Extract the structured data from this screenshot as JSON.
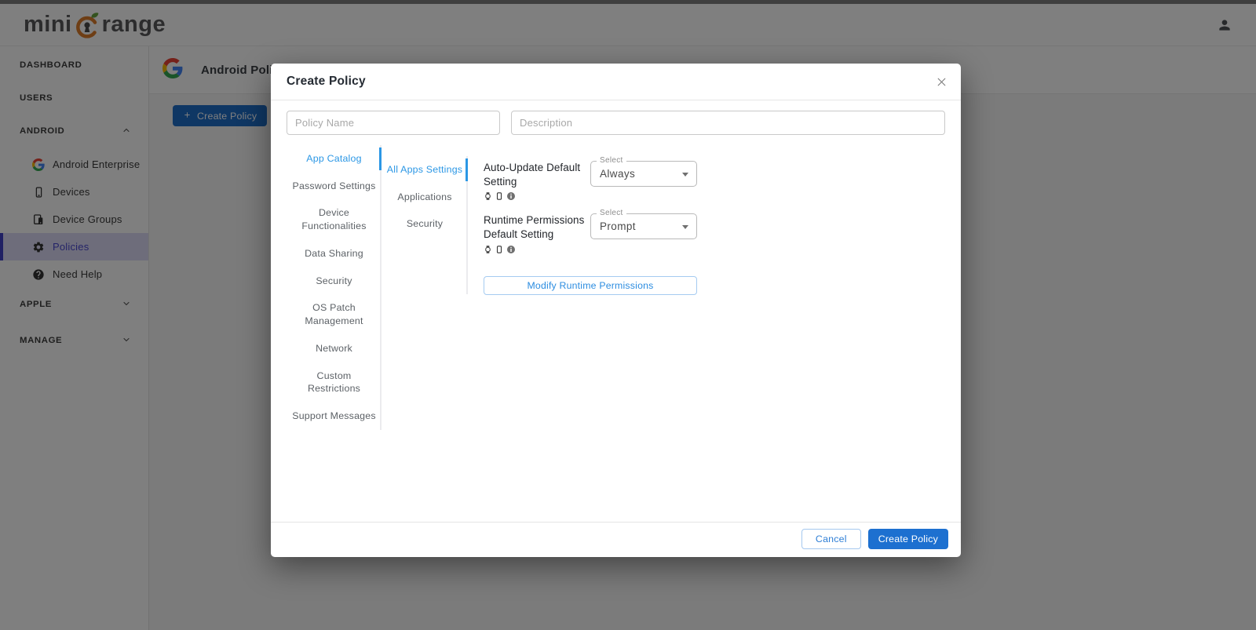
{
  "appbar": {
    "logo_mini": "mini",
    "logo_range": "range"
  },
  "sidebar": {
    "dashboard": "DASHBOARD",
    "users": "USERS",
    "android": "ANDROID",
    "apple": "APPLE",
    "manage": "MANAGE",
    "android_items": [
      {
        "label": "Android Enterprise"
      },
      {
        "label": "Devices"
      },
      {
        "label": "Device Groups"
      },
      {
        "label": "Policies"
      },
      {
        "label": "Need Help"
      }
    ]
  },
  "page": {
    "title": "Android Polic",
    "create_policy_button": "Create Policy"
  },
  "modal": {
    "title": "Create Policy",
    "policy_name_placeholder": "Policy Name",
    "description_placeholder": "Description",
    "tabs": [
      "App Catalog",
      "Password Settings",
      "Device Functionalities",
      "Data Sharing",
      "Security",
      "OS Patch Management",
      "Network",
      "Custom Restrictions",
      "Support Messages"
    ],
    "subtabs": [
      "All Apps Settings",
      "Applications",
      "Security"
    ],
    "settings": [
      {
        "label": "Auto-Update Default Setting",
        "select_label": "Select",
        "value": "Always"
      },
      {
        "label": "Runtime Permissions Default Setting",
        "select_label": "Select",
        "value": "Prompt"
      }
    ],
    "modify_button": "Modify Runtime Permissions",
    "cancel_button": "Cancel",
    "submit_button": "Create Policy"
  },
  "icons": {
    "appbar": [
      "keyhole-logo-icon",
      "user-profile-icon"
    ],
    "sidebar": [
      "google-g-icon",
      "smartphone-icon",
      "device-groups-icon",
      "gear-icon",
      "help-icon",
      "chevron-up-icon",
      "chevron-down-icon"
    ],
    "modal": [
      "close-icon",
      "watch-icon",
      "smartphone-icon",
      "info-icon",
      "caret-down-icon",
      "plus-icon"
    ]
  },
  "colors": {
    "accent_blue": "#2b97e5",
    "primary_blue": "#1d70d0",
    "active_indigo": "#4140c8",
    "brand_orange": "#DD7D2B",
    "leaf_green": "#67A53C",
    "overlay": "rgba(0,0,0,0.5)"
  }
}
